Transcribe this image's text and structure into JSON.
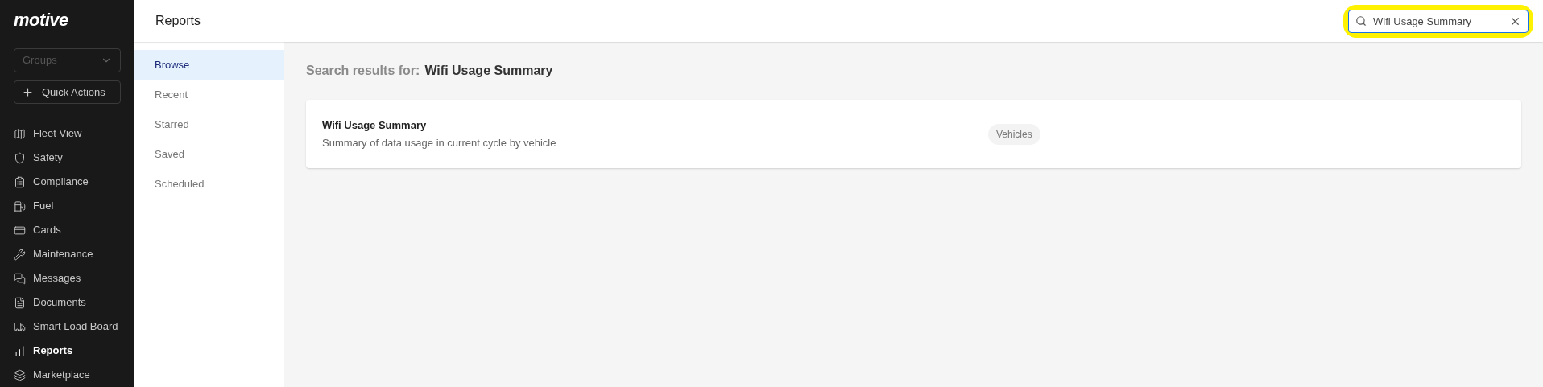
{
  "sidebar": {
    "logo": "motive",
    "groups_placeholder": "Groups",
    "quick_actions": "Quick Actions",
    "items": [
      {
        "label": "Fleet View",
        "selected": false
      },
      {
        "label": "Safety",
        "selected": false
      },
      {
        "label": "Compliance",
        "selected": false
      },
      {
        "label": "Fuel",
        "selected": false
      },
      {
        "label": "Cards",
        "selected": false
      },
      {
        "label": "Maintenance",
        "selected": false
      },
      {
        "label": "Messages",
        "selected": false
      },
      {
        "label": "Documents",
        "selected": false
      },
      {
        "label": "Smart Load Board",
        "selected": false
      },
      {
        "label": "Reports",
        "selected": true
      },
      {
        "label": "Marketplace",
        "selected": false
      }
    ]
  },
  "header": {
    "title": "Reports",
    "search": {
      "value": "Wifi Usage Summary",
      "highlighted": true
    }
  },
  "subnav": [
    {
      "label": "Browse",
      "selected": true
    },
    {
      "label": "Recent",
      "selected": false
    },
    {
      "label": "Starred",
      "selected": false
    },
    {
      "label": "Saved",
      "selected": false
    },
    {
      "label": "Scheduled",
      "selected": false
    }
  ],
  "results": {
    "prefix": "Search results for:",
    "query": "Wifi Usage Summary",
    "items": [
      {
        "title": "Wifi Usage Summary",
        "description": "Summary of data usage in current cycle by vehicle",
        "tag": "Vehicles"
      }
    ]
  }
}
